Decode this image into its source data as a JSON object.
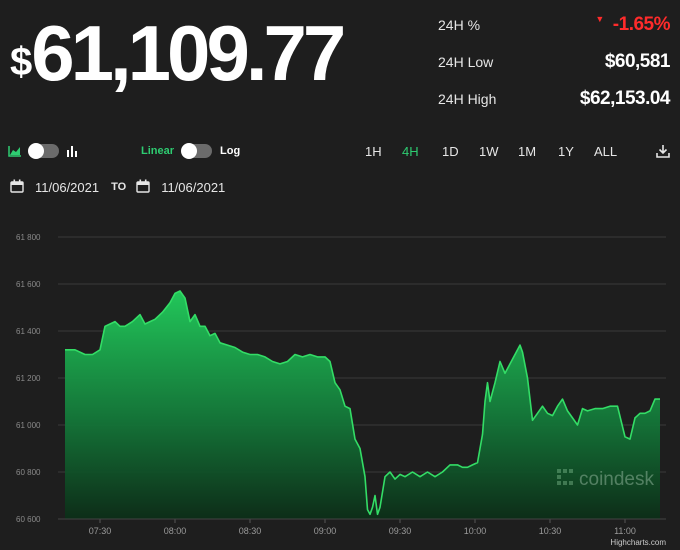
{
  "price": {
    "currency_symbol": "$",
    "value": "61,109.77"
  },
  "stats": [
    {
      "label": "24H %",
      "value": "-1.65%",
      "direction": "down"
    },
    {
      "label": "24H Low",
      "value": "$60,581"
    },
    {
      "label": "24H High",
      "value": "$62,153.04"
    }
  ],
  "controls": {
    "chart_type_left_icon": "area-chart-icon",
    "chart_type_right_icon": "bar-chart-icon",
    "scale_linear_label": "Linear",
    "scale_log_label": "Log",
    "ranges": [
      "1H",
      "4H",
      "1D",
      "1W",
      "1M",
      "1Y",
      "ALL"
    ],
    "active_range": "4H",
    "download_icon": "download-icon"
  },
  "date_range": {
    "from": "11/06/2021",
    "to_label": "TO",
    "to": "11/06/2021",
    "icon": "calendar-icon"
  },
  "watermark": "coindesk",
  "credit": "Highcharts.com",
  "colors": {
    "accent": "#2ecc71",
    "negative": "#ff2b2b",
    "background": "#1e1e1e",
    "line": "#33dd66"
  },
  "chart_data": {
    "type": "area",
    "title": "",
    "xlabel": "",
    "ylabel": "",
    "x_ticks": [
      "07:30",
      "08:00",
      "08:30",
      "09:00",
      "09:30",
      "10:00",
      "10:30",
      "11:00"
    ],
    "y_ticks": [
      "60 600",
      "60 800",
      "61 000",
      "61 200",
      "61 400",
      "61 600",
      "61 800"
    ],
    "ylim": [
      60600,
      61800
    ],
    "grid": true,
    "legend": "none",
    "series": [
      {
        "x": [
          "07:16",
          "07:20",
          "07:24",
          "07:27",
          "07:30",
          "07:32",
          "07:34",
          "07:36",
          "07:38",
          "07:40",
          "07:43",
          "07:46",
          "07:48",
          "07:50",
          "07:52",
          "07:55",
          "07:58",
          "08:00",
          "08:02",
          "08:04",
          "08:06",
          "08:08",
          "08:10",
          "08:12",
          "08:14",
          "08:16",
          "08:18",
          "08:21",
          "08:24",
          "08:27",
          "08:30",
          "08:33",
          "08:36",
          "08:39",
          "08:42",
          "08:45",
          "08:48",
          "08:51",
          "08:54",
          "08:57",
          "09:00",
          "09:02",
          "09:04",
          "09:06",
          "09:08",
          "09:10",
          "09:12",
          "09:14",
          "09:16",
          "09:17",
          "09:18",
          "09:19",
          "09:20",
          "09:21",
          "09:22",
          "09:24",
          "09:26",
          "09:28",
          "09:30",
          "09:32",
          "09:35",
          "09:38",
          "09:41",
          "09:44",
          "09:47",
          "09:50",
          "09:53",
          "09:55",
          "09:57",
          "09:59",
          "10:01",
          "10:03",
          "10:04",
          "10:05",
          "10:06",
          "10:08",
          "10:10",
          "10:12",
          "10:14",
          "10:16",
          "10:18",
          "10:19",
          "10:21",
          "10:23",
          "10:25",
          "10:27",
          "10:29",
          "10:31",
          "10:33",
          "10:35",
          "10:37",
          "10:39",
          "10:41",
          "10:43",
          "10:45",
          "10:48",
          "10:51",
          "10:54",
          "10:57",
          "11:00",
          "11:02",
          "11:04",
          "11:06",
          "11:08",
          "11:10",
          "11:12",
          "11:14"
        ],
        "values": [
          61320,
          61320,
          61300,
          61300,
          61320,
          61420,
          61430,
          61440,
          61420,
          61420,
          61440,
          61470,
          61430,
          61440,
          61450,
          61480,
          61520,
          61560,
          61570,
          61540,
          61440,
          61470,
          61420,
          61420,
          61380,
          61390,
          61350,
          61340,
          61330,
          61310,
          61300,
          61300,
          61290,
          61270,
          61260,
          61270,
          61300,
          61290,
          61300,
          61290,
          61290,
          61270,
          61180,
          61150,
          61080,
          61070,
          60940,
          60900,
          60780,
          60640,
          60620,
          60650,
          60700,
          60620,
          60650,
          60780,
          60800,
          60770,
          60790,
          60780,
          60800,
          60780,
          60800,
          60780,
          60800,
          60830,
          60830,
          60820,
          60820,
          60830,
          60840,
          60960,
          61100,
          61180,
          61100,
          61180,
          61270,
          61220,
          61260,
          61300,
          61340,
          61310,
          61200,
          61020,
          61050,
          61080,
          61050,
          61040,
          61080,
          61110,
          61060,
          61030,
          61000,
          61070,
          61060,
          61070,
          61070,
          61080,
          61080,
          60950,
          60940,
          61030,
          61050,
          61050,
          61060,
          61110,
          61110
        ]
      }
    ]
  }
}
